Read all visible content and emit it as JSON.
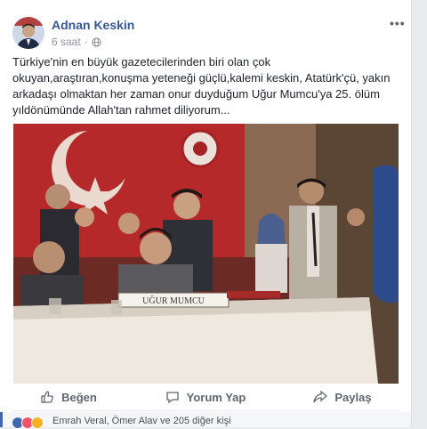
{
  "post": {
    "author": "Adnan Keskin",
    "time": "6 saat",
    "privacy_icon": "globe-icon",
    "text": "Türkiye'nin en büyük gazetecilerinden biri olan çok okuyan,araştıran,konuşma yeteneği güçlü,kalemi keskin, Atatürk'çü, yakın arkadaşı olmaktan her zaman onur duyduğum Uğur Mumcu'ya 25. ölüm yıldönümünde Allah'tan rahmet diliyorum...",
    "photo": {
      "nameplate": "UĞUR MUMCU"
    }
  },
  "actions": {
    "like": "Beğen",
    "comment": "Yorum Yap",
    "share": "Paylaş"
  },
  "reactions": {
    "summary": "Emrah Veral, Ömer Alav ve 205 diğer kişi",
    "colors": {
      "like": "#4267b2",
      "love": "#f25268",
      "haha": "#f7b125"
    }
  },
  "colors": {
    "name": "#365899",
    "meta": "#90949c",
    "text": "#1d2129"
  }
}
